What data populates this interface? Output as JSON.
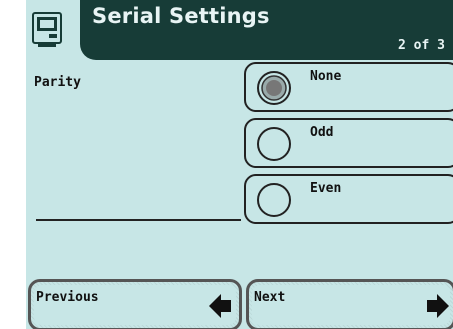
{
  "header": {
    "title": "Serial Settings",
    "page_indicator": "2 of 3",
    "icon": "device-screen-icon"
  },
  "field": {
    "label": "Parity"
  },
  "options": [
    {
      "label": "None",
      "selected": true
    },
    {
      "label": "Odd",
      "selected": false
    },
    {
      "label": "Even",
      "selected": false
    }
  ],
  "nav": {
    "previous_label": "Previous",
    "next_label": "Next",
    "previous_icon": "arrow-left-icon",
    "next_icon": "arrow-right-icon"
  },
  "colors": {
    "background": "#c7e6e6",
    "header_bar": "#173c37",
    "text": "#111111"
  }
}
